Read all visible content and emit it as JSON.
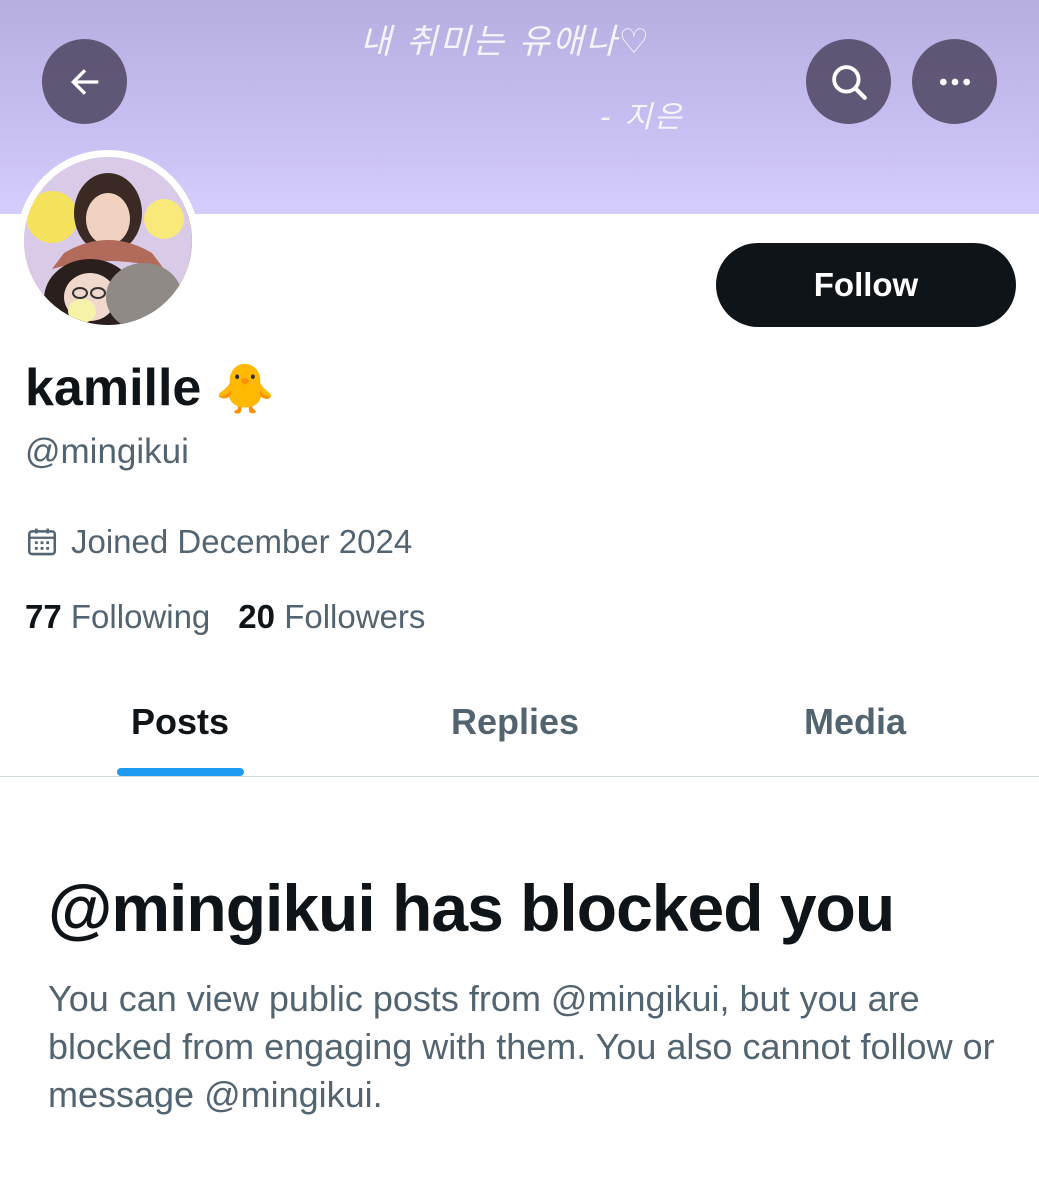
{
  "banner": {
    "handwriting_line1": "내 취미는 유애나♡",
    "handwriting_line2": "- 지은",
    "color": "#c6bdf0"
  },
  "header": {
    "back_icon": "arrow-left-icon",
    "search_icon": "search-icon",
    "more_icon": "more-horizontal-icon"
  },
  "profile": {
    "display_name": "kamille",
    "name_emoji": "🐥",
    "handle": "@mingikui",
    "joined_icon": "calendar-icon",
    "joined": "Joined December 2024",
    "following_count": "77",
    "following_label": "Following",
    "followers_count": "20",
    "followers_label": "Followers"
  },
  "actions": {
    "follow_label": "Follow"
  },
  "tabs": [
    {
      "label": "Posts",
      "active": true
    },
    {
      "label": "Replies",
      "active": false
    },
    {
      "label": "Media",
      "active": false
    }
  ],
  "blocked": {
    "title": "@mingikui has blocked you",
    "description": "You can view public posts from @mingikui, but you are blocked from engaging with them. You also cannot follow or message @mingikui."
  },
  "colors": {
    "accent": "#1d9bf0",
    "primary_text": "#0f1419",
    "secondary_text": "#536471",
    "button_bg": "#0f1419"
  }
}
